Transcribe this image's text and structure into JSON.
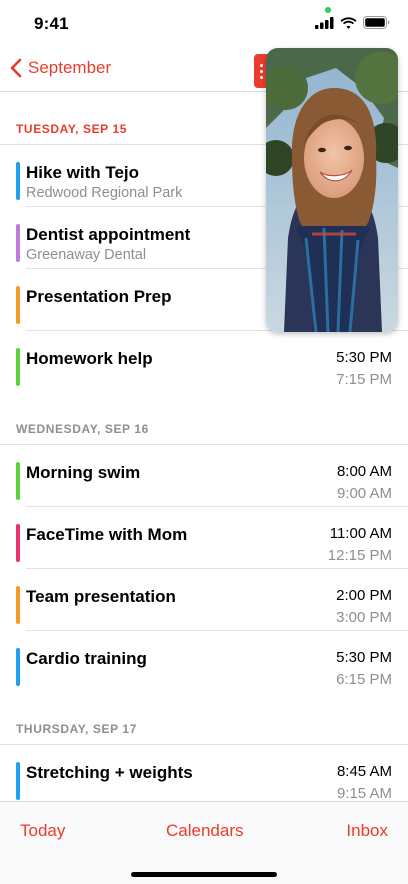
{
  "status_bar": {
    "time": "9:41"
  },
  "nav": {
    "back_label": "September"
  },
  "colors": {
    "accent": "#ea3b2e",
    "blue": "#1ea1f2",
    "purple": "#c27adb",
    "orange": "#f59a23",
    "green": "#5ad33a",
    "pink": "#e8336b"
  },
  "days": [
    {
      "label": "TUESDAY, SEP 15",
      "events": [
        {
          "title": "Hike with Tejo",
          "subtitle": "Redwood Regional Park",
          "color": "#1ea1f2"
        },
        {
          "title": "Dentist appointment",
          "subtitle": "Greenaway Dental",
          "color": "#c27adb"
        },
        {
          "title": "Presentation Prep",
          "color": "#f59a23"
        },
        {
          "title": "Homework help",
          "start": "5:30 PM",
          "end": "7:15 PM",
          "color": "#5ad33a"
        }
      ]
    },
    {
      "label": "WEDNESDAY, SEP 16",
      "events": [
        {
          "title": "Morning swim",
          "start": "8:00 AM",
          "end": "9:00 AM",
          "color": "#5ad33a"
        },
        {
          "title": "FaceTime with Mom",
          "start": "11:00 AM",
          "end": "12:15 PM",
          "color": "#e8336b"
        },
        {
          "title": "Team presentation",
          "start": "2:00 PM",
          "end": "3:00 PM",
          "color": "#f59a23"
        },
        {
          "title": "Cardio training",
          "start": "5:30 PM",
          "end": "6:15 PM",
          "color": "#1ea1f2"
        }
      ]
    },
    {
      "label": "THURSDAY, SEP 17",
      "events": [
        {
          "title": "Stretching + weights",
          "start": "8:45 AM",
          "end": "9:15 AM",
          "color": "#1ea1f2"
        }
      ]
    }
  ],
  "tabs": {
    "today": "Today",
    "calendars": "Calendars",
    "inbox": "Inbox"
  }
}
